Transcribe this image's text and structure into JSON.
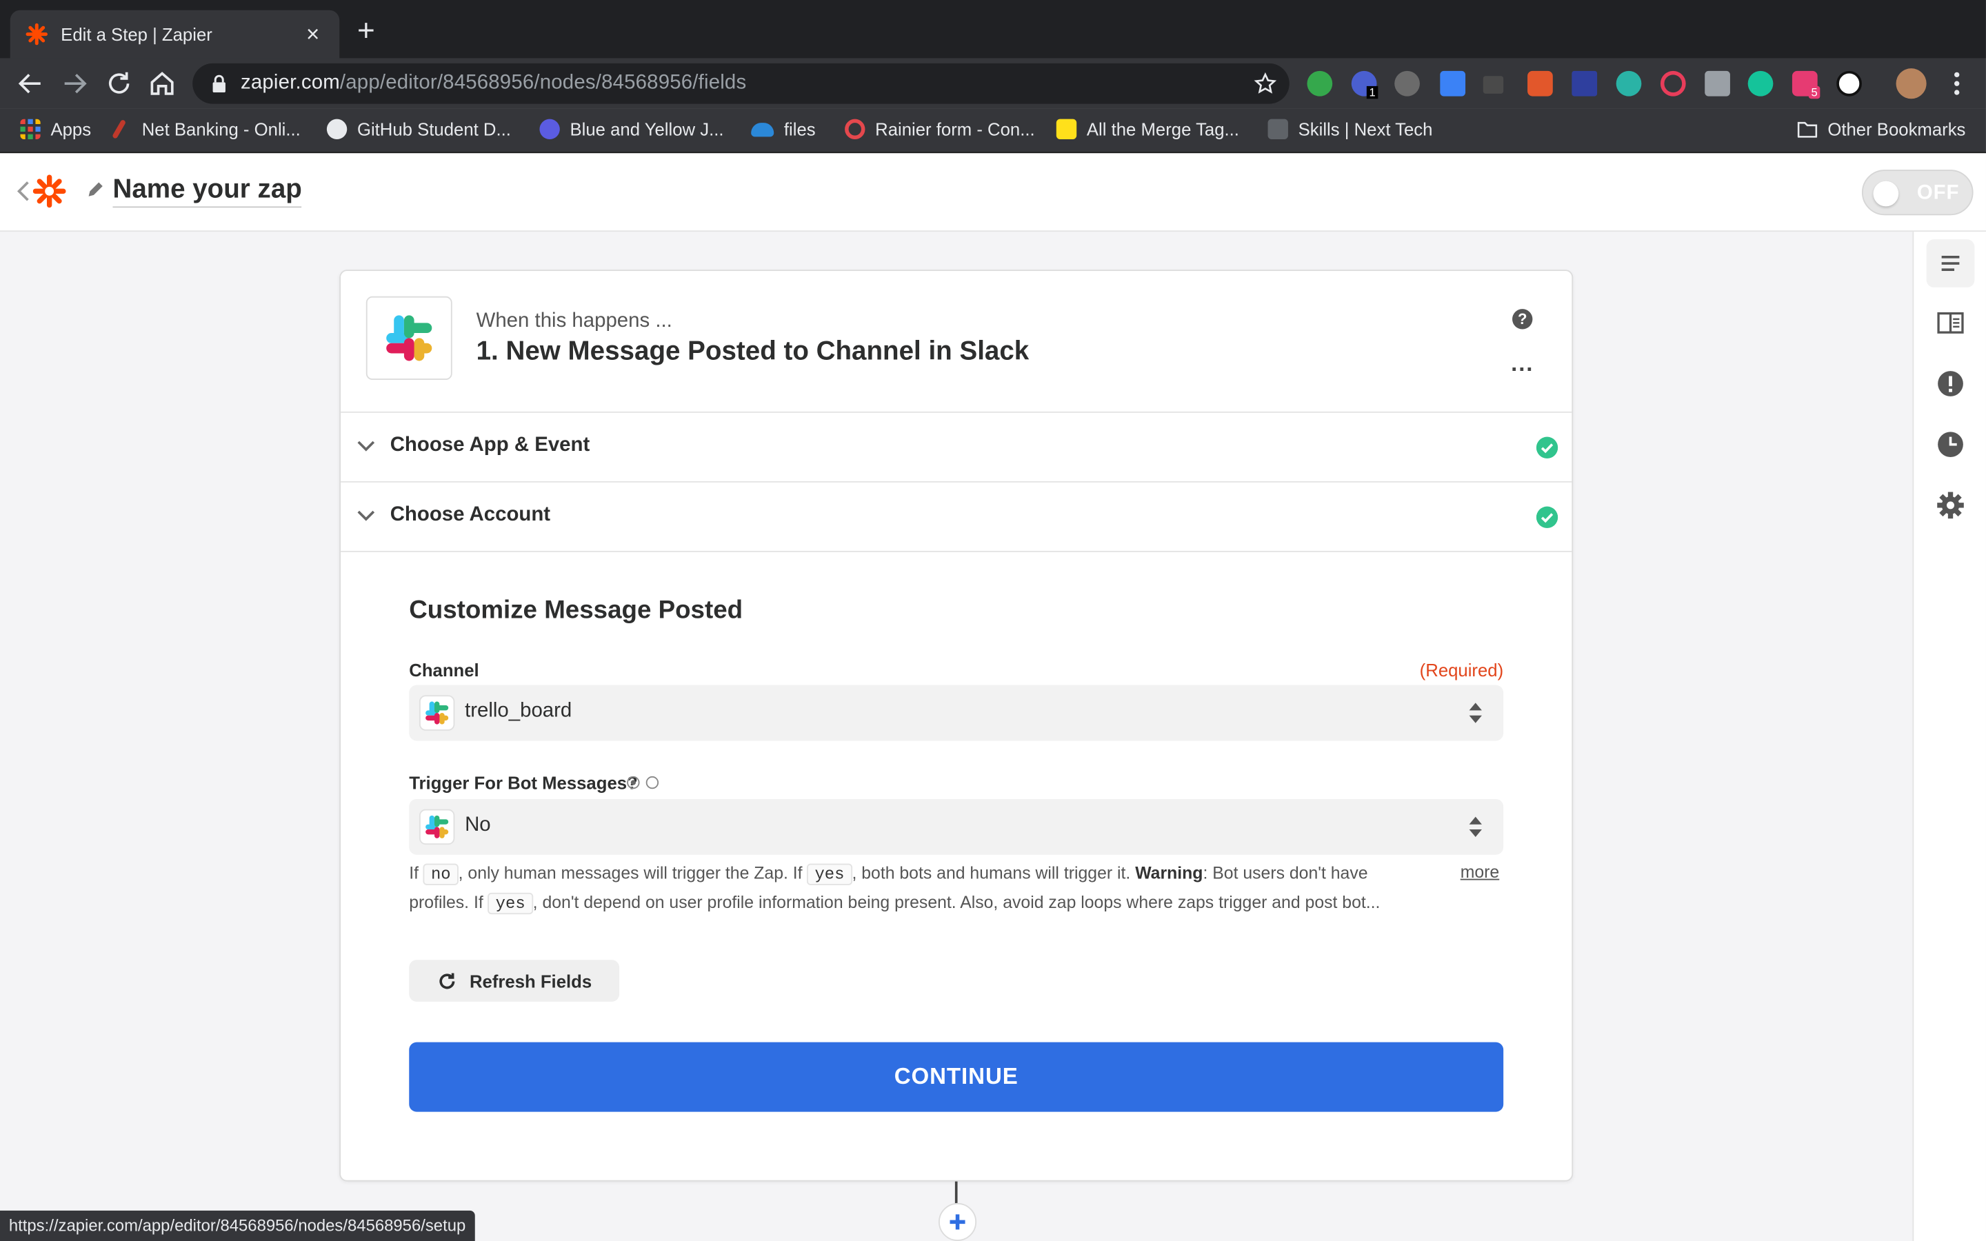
{
  "browser": {
    "tab_title": "Edit a Step | Zapier",
    "url_host": "zapier.com",
    "url_path": "/app/editor/84568956/nodes/84568956/fields",
    "extension_badge_1": "1",
    "extension_badge_2": "5",
    "bookmarks": [
      {
        "label": "Apps"
      },
      {
        "label": "Net Banking - Onli..."
      },
      {
        "label": "GitHub Student D..."
      },
      {
        "label": "Blue and Yellow J..."
      },
      {
        "label": "files"
      },
      {
        "label": "Rainier form - Con..."
      },
      {
        "label": "All the Merge Tag..."
      },
      {
        "label": "Skills | Next Tech"
      }
    ],
    "other_bookmarks": "Other Bookmarks",
    "status_url": "https://zapier.com/app/editor/84568956/nodes/84568956/setup"
  },
  "header": {
    "zap_name": "Name your zap",
    "toggle_label": "OFF"
  },
  "step": {
    "subtitle": "When this happens ...",
    "title": "1. New Message Posted to Channel in Slack",
    "help": "?",
    "more_menu": "...",
    "sections": [
      {
        "label": "Choose App & Event",
        "complete": true
      },
      {
        "label": "Choose Account",
        "complete": true
      }
    ],
    "customize": {
      "title": "Customize Message Posted",
      "channel": {
        "label": "Channel",
        "required": "(Required)",
        "value": "trello_board"
      },
      "bot_messages": {
        "label": "Trigger For Bot Messages?",
        "value": "No",
        "help": {
          "p1": "If ",
          "code_no": "no",
          "p2": ", only human messages will trigger the Zap. If ",
          "code_yes": "yes",
          "p3": ", both bots and humans will trigger it. ",
          "warning": "Warning",
          "p4": ": Bot users don't have profiles. If ",
          "p5": ", don't depend on user profile information being present. Also, avoid zap loops where zaps trigger and post bot..."
        },
        "more": "more"
      },
      "refresh_label": "Refresh Fields",
      "continue_label": "CONTINUE"
    }
  },
  "colors": {
    "zapier_orange": "#ff4a00",
    "continue_blue": "#2f6ee2",
    "check_green": "#31c48d",
    "required_red": "#e2451b"
  }
}
